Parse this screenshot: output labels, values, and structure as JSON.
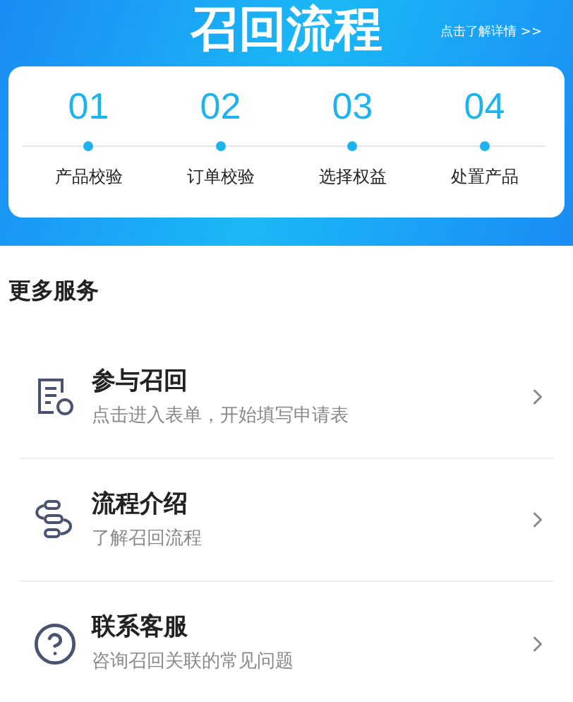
{
  "banner": {
    "title": "召回流程",
    "link": "点击了解详情 >>",
    "steps": [
      {
        "number": "01",
        "label": "产品校验"
      },
      {
        "number": "02",
        "label": "订单校验"
      },
      {
        "number": "03",
        "label": "选择权益"
      },
      {
        "number": "04",
        "label": "处置产品"
      }
    ]
  },
  "services": {
    "heading": "更多服务",
    "items": [
      {
        "kind": "form",
        "title": "参与召回",
        "subtitle": "点击进入表单，开始填写申请表"
      },
      {
        "kind": "flow",
        "title": "流程介绍",
        "subtitle": "了解召回流程"
      },
      {
        "kind": "help",
        "title": "联系客服",
        "subtitle": "咨询召回关联的常见问题"
      }
    ]
  }
}
